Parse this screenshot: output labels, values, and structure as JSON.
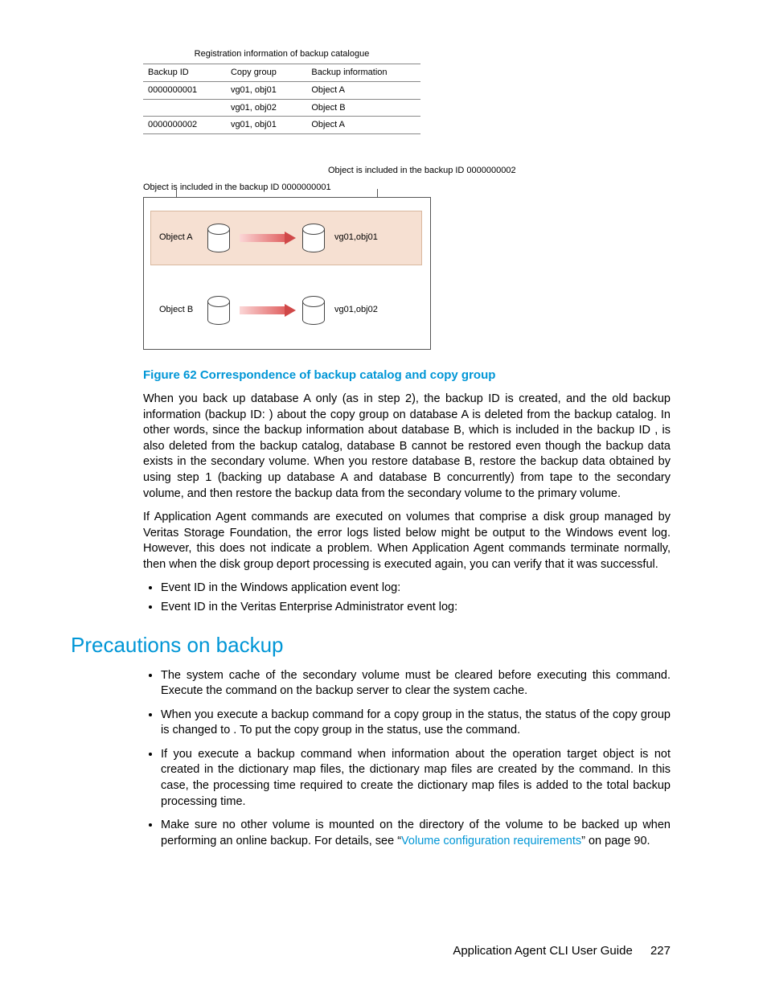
{
  "table": {
    "title": "Registration information of backup catalogue",
    "headers": {
      "id": "Backup ID",
      "group": "Copy group",
      "info": "Backup information"
    },
    "rows": [
      {
        "id": "0000000001",
        "group": "vg01, obj01",
        "info": "Object  A"
      },
      {
        "id": "",
        "group": "vg01, obj02",
        "info": "Object  B"
      },
      {
        "id": "0000000002",
        "group": "vg01, obj01",
        "info": "Object  A"
      }
    ]
  },
  "diagram": {
    "label_right": "Object is included in the backup ID 0000000002",
    "label_left": "Object is included in the backup ID  0000000001",
    "rows": [
      {
        "obj": "Object  A",
        "vg": "vg01,obj01"
      },
      {
        "obj": "Object B",
        "vg": "vg01,obj02"
      }
    ]
  },
  "caption": "Figure 62 Correspondence of backup catalog and copy group",
  "paras": {
    "p1a": "When you back up database A only (as in step 2), the backup ID ",
    "p1b": " is created, and the old backup information (backup ID: ",
    "p1c": ") about the copy group ",
    "p1d": " on database A is deleted from the backup catalog. In other words, since the backup information about database B, which is included in the backup ID ",
    "p1e": ", is also deleted from the backup catalog, database B cannot be restored even though the backup data exists in the secondary volume. When you restore database B, restore the backup data obtained by using step 1 (backing up database A and database B concurrently) from tape to the secondary volume, and then restore the backup data from the secondary volume to the primary volume.",
    "p2": "If Application Agent commands are executed on volumes that comprise a disk group managed by Veritas Storage Foundation, the error logs listed below might be output to the Windows event log. However, this does not indicate a problem. When Application Agent commands terminate normally, then when the disk group deport processing is executed again, you can verify that it was successful."
  },
  "events": [
    "Event ID in the Windows application event log:",
    "Event ID in the Veritas Enterprise Administrator event log:"
  ],
  "section_title": "Precautions on backup",
  "precautions": {
    "b1a": "The system cache of the secondary volume must be cleared before executing this command. Execute the ",
    "b1b": " command on the backup server to clear the system cache.",
    "b2a": "When you execute a backup command for a copy group in the ",
    "b2b": " status, the status of the copy group is changed to ",
    "b2c": ". To put the copy group in the ",
    "b2d": " status, use the ",
    "b2e": " command.",
    "b3": "If you execute a backup command when information about the operation target object is not created in the dictionary map files, the dictionary map files are created by the command. In this case, the processing time required to create the dictionary map files is added to the total backup processing time.",
    "b4a": "Make sure no other volume is mounted on the directory of the volume to be backed up when performing an online backup. For details, see “",
    "b4link": "Volume configuration requirements",
    "b4b": "” on page 90."
  },
  "footer": {
    "title": "Application Agent CLI User Guide",
    "page": "227"
  }
}
